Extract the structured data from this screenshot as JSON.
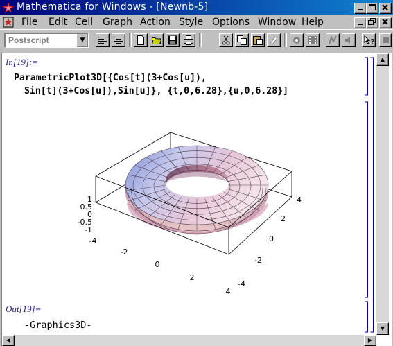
{
  "window": {
    "title": "Mathematica for Windows - [Newnb-5]"
  },
  "menu": {
    "items": [
      {
        "label": "File"
      },
      {
        "label": "Edit"
      },
      {
        "label": "Cell"
      },
      {
        "label": "Graph"
      },
      {
        "label": "Action"
      },
      {
        "label": "Style"
      },
      {
        "label": "Options"
      },
      {
        "label": "Window"
      },
      {
        "label": "Help"
      }
    ]
  },
  "toolbar": {
    "style_value": "Postscript",
    "icons": [
      "align-left-icon",
      "align-center-icon",
      "new-icon",
      "open-icon",
      "save-icon",
      "print-icon",
      "cut-icon",
      "copy-icon",
      "paste-icon",
      "clear-icon",
      "evaluate-icon",
      "animate-icon",
      "graphics-icon",
      "sound-icon",
      "help-icon"
    ]
  },
  "notebook": {
    "input_label": "In[19]:=",
    "input_line1": "ParametricPlot3D[{Cos[t](3+Cos[u]),",
    "input_line2": " Sin[t](3+Cos[u]),Sin[u]}, {t,0,6.28},{u,0,6.28}]",
    "output_label": "Out[19]=",
    "output_text": "-Graphics3D-"
  },
  "plot": {
    "ticks_z": [
      "1",
      "0.5",
      "0",
      "-0.5",
      "-1"
    ],
    "ticks_x": [
      "-4",
      "-2",
      "0",
      "2",
      "4"
    ],
    "ticks_y": [
      "4",
      "2",
      "0",
      "-2",
      "-4"
    ],
    "colors": {
      "torus_light": "#f4eef8",
      "torus_blue": "#8a9ad8",
      "torus_pink": "#e0b0c0",
      "torus_dark": "#7a4a6a"
    }
  }
}
